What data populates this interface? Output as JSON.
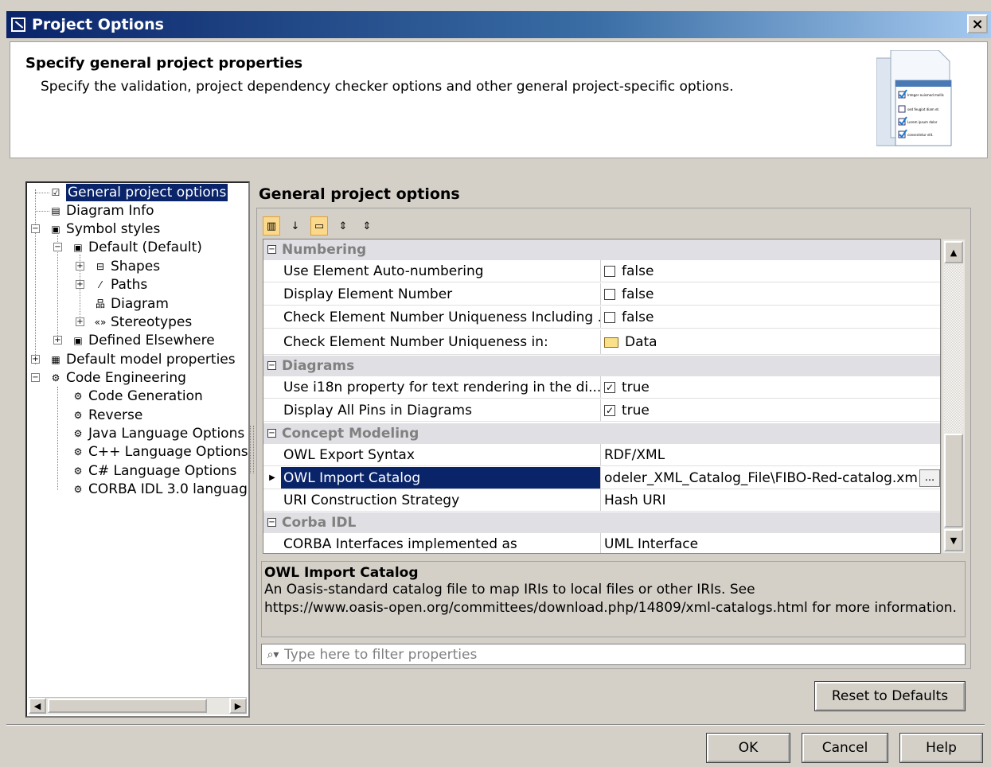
{
  "window": {
    "title": "Project Options",
    "close_glyph": "×"
  },
  "header": {
    "title": "Specify general project properties",
    "subtitle": "Specify the validation, project dependency checker options and other general project-specific options.",
    "image_lines": [
      "Integer euismod mollis",
      "sed feugiat diam et.",
      "Lorem ipsum dolor",
      "consectetur elit."
    ]
  },
  "tree": {
    "items": [
      {
        "label": "General project options",
        "icon": "checkbox-icon",
        "glyph": "☑"
      },
      {
        "label": "Diagram Info",
        "icon": "table-icon",
        "glyph": "▤"
      },
      {
        "label": "Symbol styles",
        "icon": "styles-icon",
        "glyph": "▣"
      },
      {
        "label": "Default (Default)",
        "icon": "styles-icon",
        "glyph": "▣"
      },
      {
        "label": "Shapes",
        "icon": "shapes-icon",
        "glyph": "⊟"
      },
      {
        "label": "Paths",
        "icon": "path-icon",
        "glyph": "⁄"
      },
      {
        "label": "Diagram",
        "icon": "diagram-icon",
        "glyph": "品"
      },
      {
        "label": "Stereotypes",
        "icon": "stereotype-icon",
        "glyph": "«»"
      },
      {
        "label": "Defined Elsewhere",
        "icon": "styles-icon",
        "glyph": "▣"
      },
      {
        "label": "Default model properties",
        "icon": "properties-icon",
        "glyph": "▦"
      },
      {
        "label": "Code Engineering",
        "icon": "code-icon",
        "glyph": "⚙"
      },
      {
        "label": "Code Generation",
        "icon": "gears-icon",
        "glyph": "⚙"
      },
      {
        "label": "Reverse",
        "icon": "gears-icon",
        "glyph": "⚙"
      },
      {
        "label": "Java Language Options",
        "icon": "code-icon",
        "glyph": "⚙"
      },
      {
        "label": "C++ Language Options",
        "icon": "code-icon",
        "glyph": "⚙"
      },
      {
        "label": "C# Language Options",
        "icon": "code-icon",
        "glyph": "⚙"
      },
      {
        "label": "CORBA IDL 3.0 languag",
        "icon": "code-icon",
        "glyph": "⚙"
      }
    ]
  },
  "main": {
    "title": "General project options",
    "toolbar": [
      {
        "name": "categorized-icon",
        "glyph": "▥"
      },
      {
        "name": "sort-alpha-icon",
        "glyph": "↓"
      },
      {
        "name": "description-toggle-icon",
        "glyph": "▭"
      },
      {
        "name": "expand-all-icon",
        "glyph": "⇕"
      },
      {
        "name": "collapse-all-icon",
        "glyph": "⇕"
      }
    ],
    "categories": {
      "numbering": "Numbering",
      "diagrams": "Diagrams",
      "concept": "Concept Modeling",
      "corba": "Corba IDL"
    },
    "props": {
      "auto_numbering": {
        "name": "Use Element Auto-numbering",
        "value": "false",
        "checked": ""
      },
      "display_number": {
        "name": "Display Element Number",
        "value": "false",
        "checked": ""
      },
      "check_uniqueness_including": {
        "name": "Check Element Number Uniqueness Including ...",
        "value": "false",
        "checked": ""
      },
      "check_uniqueness_in": {
        "name": "Check Element Number Uniqueness in:",
        "value": "Data"
      },
      "i18n": {
        "name": "Use i18n property for text rendering in the di...",
        "value": "true",
        "checked": "✓"
      },
      "display_pins": {
        "name": "Display All Pins in Diagrams",
        "value": "true",
        "checked": "✓"
      },
      "owl_export": {
        "name": "OWL Export Syntax",
        "value": "RDF/XML"
      },
      "owl_import": {
        "name": "OWL Import Catalog",
        "value": "odeler_XML_Catalog_File\\FIBO-Red-catalog.xml",
        "button": "..."
      },
      "uri_strategy": {
        "name": "URI Construction Strategy",
        "value": "Hash URI"
      },
      "corba_interfaces": {
        "name": "CORBA Interfaces implemented as",
        "value": "UML Interface"
      }
    },
    "description": {
      "title": "OWL Import Catalog",
      "line1": "An Oasis-standard catalog file to map IRIs to local files or other IRIs. See",
      "line2": "https://www.oasis-open.org/committees/download.php/14809/xml-catalogs.html for more information."
    },
    "filter": {
      "placeholder": "Type here to filter properties"
    }
  },
  "buttons": {
    "reset": "Reset to Defaults",
    "ok": "OK",
    "cancel": "Cancel",
    "help": "Help"
  },
  "colors": {
    "selection": "#0a246a",
    "title_gradient_start": "#0a246a",
    "dialog_bg": "#d4d0c8"
  }
}
